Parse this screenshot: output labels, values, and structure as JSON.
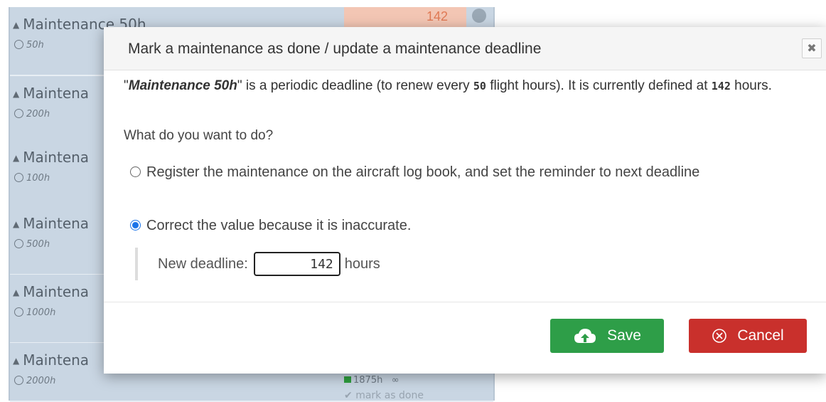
{
  "background": {
    "rows": [
      {
        "name": "Maintenance 50h",
        "interval": "50h"
      },
      {
        "name": "Maintena",
        "interval": "200h"
      },
      {
        "name": "Maintena",
        "interval": "100h"
      },
      {
        "name": "Maintena",
        "interval": "500h"
      },
      {
        "name": "Maintena",
        "interval": "1000h"
      },
      {
        "name": "Maintena",
        "interval": "2000h"
      }
    ],
    "top_value": "142",
    "footer_value": "1875h",
    "footer_infinity": "∞",
    "footer_mark": "mark as done"
  },
  "modal": {
    "title": "Mark a maintenance as done / update a maintenance deadline",
    "close_label": "✖",
    "desc_name": "Maintenance 50h",
    "desc_part1": " is a periodic deadline (to renew every ",
    "desc_interval": "50",
    "desc_part2": " flight hours). It is currently defined at ",
    "desc_current": "142",
    "desc_part3": " hours.",
    "question": "What do you want to do?",
    "option_register": "Register the maintenance on the aircraft log book, and set the reminder to next deadline",
    "option_correct": "Correct the value because it is inaccurate.",
    "selected_option": "correct",
    "deadline_label": "New deadline:",
    "deadline_value": "142",
    "deadline_unit": "hours",
    "save_label": "Save",
    "cancel_label": "Cancel"
  },
  "colors": {
    "save": "#2e9e48",
    "cancel": "#c9302c",
    "row_bg": "#c9d6e3",
    "accent": "#1a73e8"
  }
}
